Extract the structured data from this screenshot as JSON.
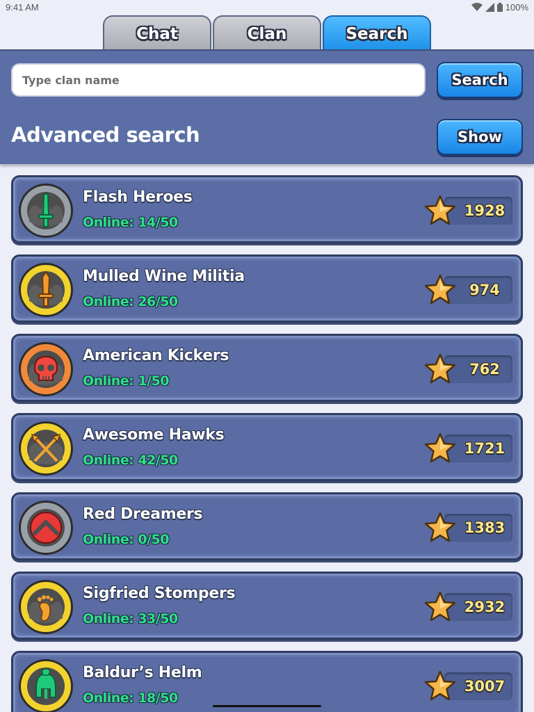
{
  "status_bar": {
    "time": "9:41 AM",
    "battery": "100%"
  },
  "tabs": [
    {
      "label": "Chat",
      "active": false
    },
    {
      "label": "Clan",
      "active": false
    },
    {
      "label": "Search",
      "active": true
    }
  ],
  "search": {
    "placeholder": "Type clan name",
    "value": "",
    "button_label": "Search"
  },
  "advanced": {
    "title": "Advanced search",
    "button_label": "Show"
  },
  "clans": [
    {
      "name": "Flash Heroes",
      "online": "Online: 14/50",
      "score": "1928",
      "emblem": "green-sword-icon",
      "emblem_color": "#9aa0a8"
    },
    {
      "name": "Mulled Wine Militia",
      "online": "Online: 26/50",
      "score": "974",
      "emblem": "orange-sword-icon",
      "emblem_color": "#f2d22e"
    },
    {
      "name": "American Kickers",
      "online": "Online: 1/50",
      "score": "762",
      "emblem": "skull-icon",
      "emblem_color": "#f08a3a"
    },
    {
      "name": "Awesome Hawks",
      "online": "Online: 42/50",
      "score": "1721",
      "emblem": "crossed-spears-icon",
      "emblem_color": "#f2d22e"
    },
    {
      "name": "Red Dreamers",
      "online": "Online: 0/50",
      "score": "1383",
      "emblem": "red-chevron-icon",
      "emblem_color": "#9aa0a8"
    },
    {
      "name": "Sigfried Stompers",
      "online": "Online: 33/50",
      "score": "2932",
      "emblem": "footprint-icon",
      "emblem_color": "#f2d22e"
    },
    {
      "name": "Baldur’s Helm",
      "online": "Online: 18/50",
      "score": "3007",
      "emblem": "helmet-icon",
      "emblem_color": "#f2d22e"
    }
  ],
  "colors": {
    "panel": "#5b6fa6",
    "tab_active": "#2a9df4",
    "online_text": "#2fe08a",
    "score_text": "#ffe88a"
  }
}
